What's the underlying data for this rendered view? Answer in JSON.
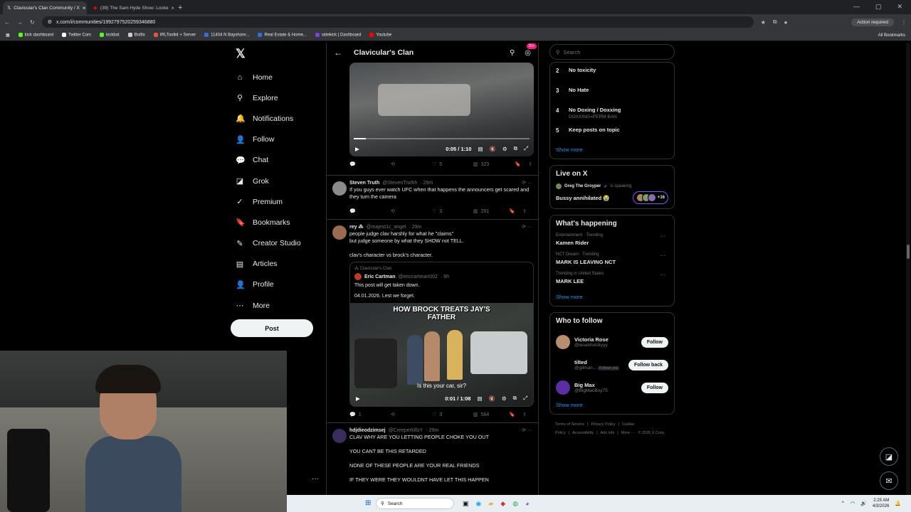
{
  "browser": {
    "tabs": [
      {
        "title": "Clavicular's Clan Community / X",
        "active": true,
        "icon_color": "#000000"
      },
      {
        "title": "(39) The Sam Hyde Show: Locke",
        "active": false,
        "icon_color": "#ff0000"
      }
    ],
    "url": "x.com/i/communities/1992797520259346880",
    "action_required": "Action required",
    "bookmarks": [
      {
        "label": "kick dashboard",
        "color": "#53fc18"
      },
      {
        "label": "Twitter Com",
        "color": "#ffffff"
      },
      {
        "label": "kickbot",
        "color": "#53fc18"
      },
      {
        "label": "Botfix",
        "color": "#cccccc"
      },
      {
        "label": "IRLToolkit + Server",
        "color": "#e5533d"
      },
      {
        "label": "11404 N Bayshore...",
        "color": "#2f6fdd"
      },
      {
        "label": "Real Estate & Home...",
        "color": "#2f6fdd"
      },
      {
        "label": "sidekick | Dashboard",
        "color": "#7b3fe4"
      },
      {
        "label": "Youtube",
        "color": "#ff0000"
      }
    ],
    "all_bookmarks": "All Bookmarks"
  },
  "nav": {
    "items": [
      {
        "label": "Home",
        "icon": "home-icon",
        "glyph": "⌂"
      },
      {
        "label": "Explore",
        "icon": "search-icon",
        "glyph": "⚲"
      },
      {
        "label": "Notifications",
        "icon": "bell-icon",
        "glyph": "🔔"
      },
      {
        "label": "Follow",
        "icon": "follow-icon",
        "glyph": "👤"
      },
      {
        "label": "Chat",
        "icon": "chat-icon",
        "glyph": "💬"
      },
      {
        "label": "Grok",
        "icon": "grok-icon",
        "glyph": "◪"
      },
      {
        "label": "Premium",
        "icon": "premium-icon",
        "glyph": "✓"
      },
      {
        "label": "Bookmarks",
        "icon": "bookmark-icon",
        "glyph": "🔖"
      },
      {
        "label": "Creator Studio",
        "icon": "creator-studio-icon",
        "glyph": "✎"
      },
      {
        "label": "Articles",
        "icon": "articles-icon",
        "glyph": "▤"
      },
      {
        "label": "Profile",
        "icon": "profile-icon",
        "glyph": "👤"
      },
      {
        "label": "More",
        "icon": "more-icon",
        "glyph": "⋯"
      }
    ],
    "post_label": "Post"
  },
  "main": {
    "title": "Clavicular's Clan",
    "notif_badge": "20+",
    "first_video": {
      "time": "0:05 / 1:10",
      "progress": 0.07,
      "replies": "",
      "reposts": "",
      "likes": "5",
      "views": "323"
    },
    "tweets": [
      {
        "name": "Steven Truth",
        "handle": "@StevenTruthh",
        "time": "· 29m",
        "lines": [
          "If you guys ever watch UFC when that happens the announcers get scared and they turn the camera"
        ],
        "replies": "",
        "reposts": "",
        "likes": "3",
        "views": "291"
      },
      {
        "name": "rey ⁂",
        "handle": "@majest1c_angel",
        "time": "· 29m",
        "lines": [
          "people judge clav harshly for what he \"claims\"\nbut judge someone by what they SHOW not TELL.",
          "clav's character vs brock's character."
        ],
        "quote": {
          "community": "Clavicular's Clan",
          "name": "Eric Cartman",
          "handle": "@ericcartman002",
          "time": "· 6h",
          "lines": [
            "This post will get taken down.",
            "04.01.2026. Lest we forget."
          ],
          "video_caption": "HOW BROCK TREATS JAY'S FATHER",
          "video_sub": "Is this your car, sir?",
          "video_time": "0:01 / 1:08"
        },
        "replies": "1",
        "reposts": "",
        "likes": "3",
        "views": "564"
      },
      {
        "name": "hdjdieodzimsej",
        "handle": "@CreeperkillzY",
        "time": "· 29m",
        "lines": [
          "CLAV WHY ARE YOU LETTING PEOPLE CHOKE YOU OUT",
          "YOU CANT BE THIS RETARDED",
          "NONE OF THESE PEOPLE ARE YOUR REAL FRIENDS",
          "IF THEY WERE THEY WOULDNT HAVE LET THIS HAPPEN"
        ]
      }
    ]
  },
  "right": {
    "search_placeholder": "Search",
    "rules": [
      {
        "n": "2",
        "title": "No toxicity",
        "desc": ""
      },
      {
        "n": "3",
        "title": "No Hate",
        "desc": ""
      },
      {
        "n": "4",
        "title": "No Doxing / Doxxing",
        "desc": "DOXXING=PERM BAN"
      },
      {
        "n": "5",
        "title": "Keep posts on topic",
        "desc": ""
      }
    ],
    "show_more": "Show more",
    "live": {
      "heading": "Live on X",
      "host": "Greg The Groyper",
      "status": "is speaking",
      "title": "Bussy annihilated 😭",
      "extra": "+16"
    },
    "happening": {
      "heading": "What's happening",
      "trends": [
        {
          "ctx": "Entertainment · Trending",
          "name": "Kamen Rider"
        },
        {
          "ctx": "NCT Dream · Trending",
          "name": "MARK IS LEAVING NCT"
        },
        {
          "ctx": "Trending in United States",
          "name": "MARK LEE"
        }
      ]
    },
    "who_to_follow": {
      "heading": "Who to follow",
      "users": [
        {
          "name": "Victoria Rose",
          "handle": "@woahhvickyyy",
          "extra": "",
          "button": "Follow",
          "color": "#b98e6e"
        },
        {
          "name": "tilted",
          "handle": "@gilman...",
          "extra": "Follows you",
          "button": "Follow back",
          "color": "#000000"
        },
        {
          "name": "Big Max",
          "handle": "@BigMacBoy75",
          "extra": "",
          "button": "Follow",
          "color": "#5b2ea6"
        }
      ]
    },
    "footer": [
      "Terms of Service",
      "|",
      "Privacy Policy",
      "|",
      "Cookie Policy",
      "|",
      "Accessibility",
      "|",
      "Ads info",
      "|",
      "More ···",
      "© 2026 X Corp."
    ]
  },
  "taskbar": {
    "search": "Search",
    "time": "2:25 AM",
    "date": "4/3/2026"
  }
}
